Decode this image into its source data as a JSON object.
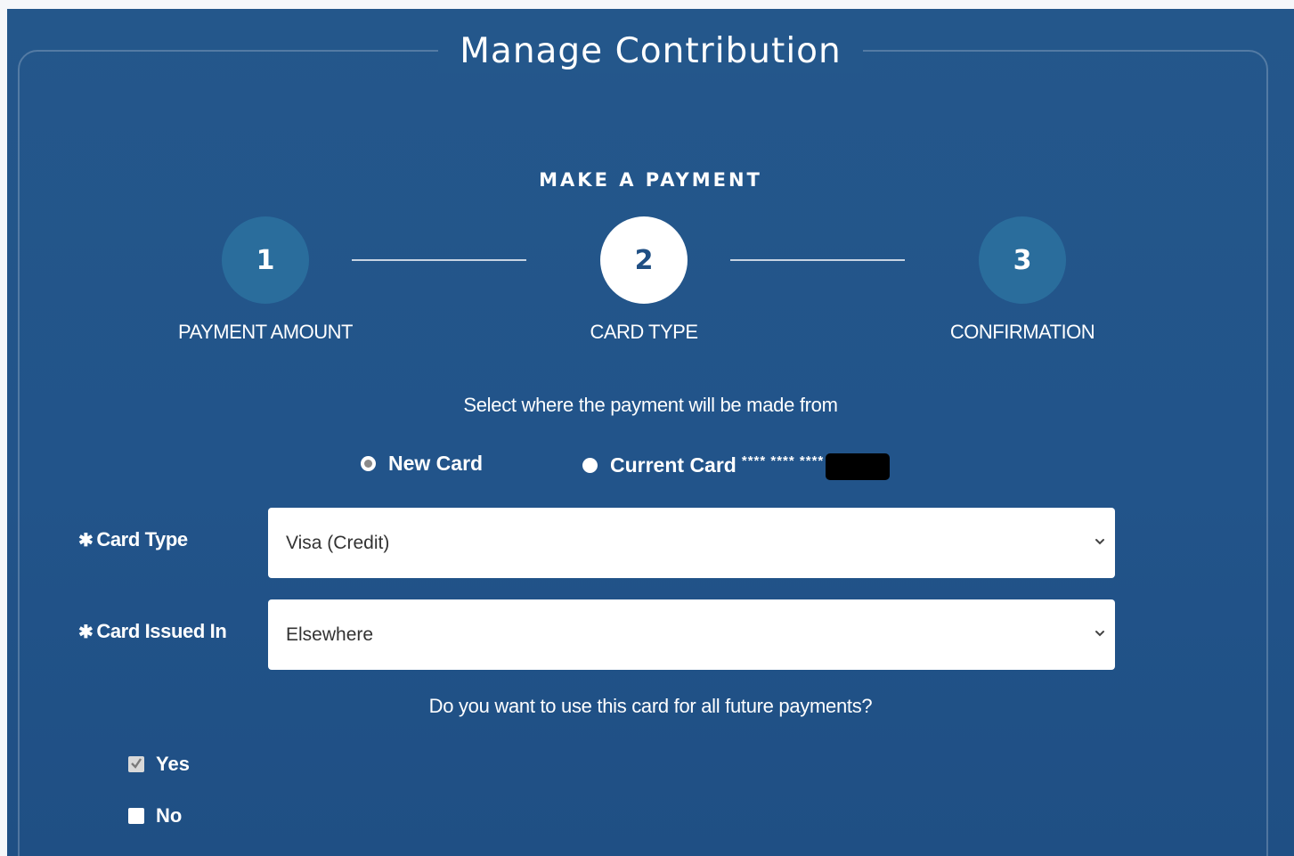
{
  "page": {
    "title": "Manage Contribution",
    "heading": "MAKE A PAYMENT"
  },
  "steps": [
    {
      "number": "1",
      "label": "PAYMENT AMOUNT",
      "active": false
    },
    {
      "number": "2",
      "label": "CARD TYPE",
      "active": true
    },
    {
      "number": "3",
      "label": "CONFIRMATION",
      "active": false
    }
  ],
  "payment_source": {
    "prompt": "Select where the payment will be made from",
    "new_card_label": "New Card",
    "new_card_selected": true,
    "current_card_label": "Current Card",
    "current_card_masked": "**** **** ****",
    "current_card_selected": false
  },
  "form": {
    "card_type": {
      "required_mark": "✱",
      "label": "Card Type",
      "value": "Visa (Credit)"
    },
    "card_issued_in": {
      "required_mark": "✱",
      "label": "Card Issued In",
      "value": "Elsewhere"
    }
  },
  "future_payments": {
    "question": "Do you want to use this card for all future payments?",
    "yes_label": "Yes",
    "yes_checked": true,
    "no_label": "No",
    "no_checked": false
  },
  "colors": {
    "background": "#24578b",
    "step_inactive": "#2a6d9c",
    "step_active": "#ffffff",
    "text": "#ffffff"
  }
}
